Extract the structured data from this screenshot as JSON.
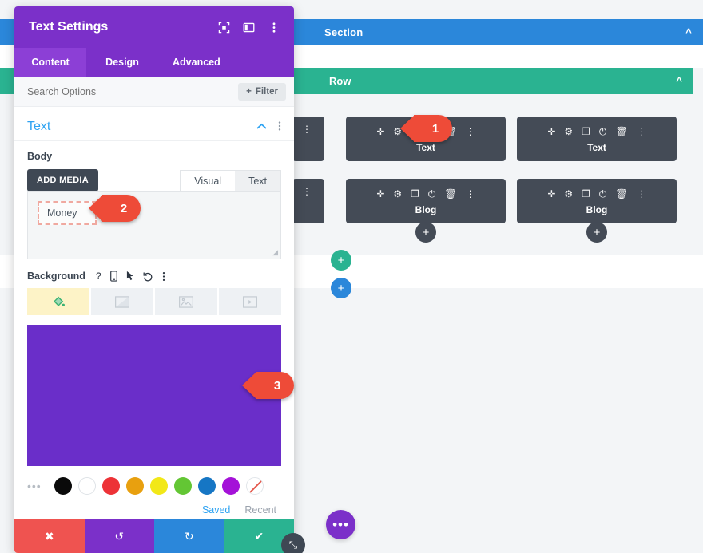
{
  "canvas": {
    "section": {
      "label": "Section",
      "collapse_icon": "chevron-up-icon",
      "color": "#2b87da"
    },
    "row": {
      "label": "Row",
      "collapse_icon": "chevron-up-icon",
      "color": "#2ab391"
    },
    "module_icons": [
      "move-icon",
      "gear-icon",
      "duplicate-icon",
      "power-toggle-icon",
      "trash-icon",
      "kebab-menu-icon"
    ],
    "columns": [
      {
        "clipped": true,
        "modules": [
          {
            "label": ""
          },
          {
            "label": ""
          }
        ]
      },
      {
        "modules": [
          {
            "label": "Text"
          },
          {
            "label": "Blog"
          }
        ],
        "add_module_label": "+"
      },
      {
        "modules": [
          {
            "label": "Text"
          },
          {
            "label": "Blog"
          }
        ],
        "add_module_label": "+"
      }
    ],
    "add_row_label": "+",
    "add_section_label": "+",
    "divi_menu_label": "•••"
  },
  "panel": {
    "title": "Text Settings",
    "header_icons": [
      "expand-icon",
      "layout-toggle-icon",
      "kebab-menu-icon"
    ],
    "tabs": [
      {
        "label": "Content",
        "active": true
      },
      {
        "label": "Design",
        "active": false
      },
      {
        "label": "Advanced",
        "active": false
      }
    ],
    "search": {
      "placeholder": "Search Options",
      "value": ""
    },
    "filter_button": {
      "label": "Filter",
      "icon": "plus-icon"
    },
    "group": {
      "title": "Text",
      "collapse_icon": "chevron-up-icon",
      "kebab_icon": "kebab-menu-icon"
    },
    "body_field": {
      "label": "Body",
      "add_media_label": "ADD MEDIA",
      "editor_tabs": [
        {
          "label": "Visual",
          "active": false
        },
        {
          "label": "Text",
          "active": true
        }
      ],
      "content": "Money"
    },
    "background": {
      "label": "Background",
      "option_icons": [
        "help-icon",
        "responsive-icon",
        "hover-icon",
        "reset-icon",
        "kebab-menu-icon"
      ],
      "tabs": [
        {
          "name": "background-color-tab",
          "icon": "paint-bucket-icon",
          "active": true
        },
        {
          "name": "background-gradient-tab",
          "icon": "gradient-icon",
          "active": false
        },
        {
          "name": "background-image-tab",
          "icon": "image-icon",
          "active": false
        },
        {
          "name": "background-video-tab",
          "icon": "video-icon",
          "active": false
        }
      ],
      "selected_color": "#6a2ec9",
      "more_colors_label": "•••",
      "swatches": [
        {
          "name": "black",
          "hex": "#0a0a0a"
        },
        {
          "name": "white",
          "hex": "#ffffff"
        },
        {
          "name": "red",
          "hex": "#ed3237"
        },
        {
          "name": "orange",
          "hex": "#e8a00f"
        },
        {
          "name": "yellow",
          "hex": "#f2e818"
        },
        {
          "name": "green",
          "hex": "#63c634"
        },
        {
          "name": "blue",
          "hex": "#1676c4"
        },
        {
          "name": "purple",
          "hex": "#a412d8"
        },
        {
          "name": "transparent",
          "hex": "transparent"
        }
      ],
      "saved_label": "Saved",
      "recent_label": "Recent"
    },
    "footer": [
      {
        "name": "cancel-button",
        "icon": "close-icon",
        "glyph": "✖",
        "color": "#ef5350"
      },
      {
        "name": "undo-button",
        "icon": "undo-icon",
        "glyph": "↺",
        "color": "#7b30c9"
      },
      {
        "name": "redo-button",
        "icon": "redo-icon",
        "glyph": "↻",
        "color": "#2b87da"
      },
      {
        "name": "save-button",
        "icon": "check-icon",
        "glyph": "✔",
        "color": "#2ab391"
      }
    ],
    "resize_handle_icon": "resize-diagonal-icon"
  },
  "annotations": [
    {
      "number": "1"
    },
    {
      "number": "2"
    },
    {
      "number": "3"
    }
  ]
}
